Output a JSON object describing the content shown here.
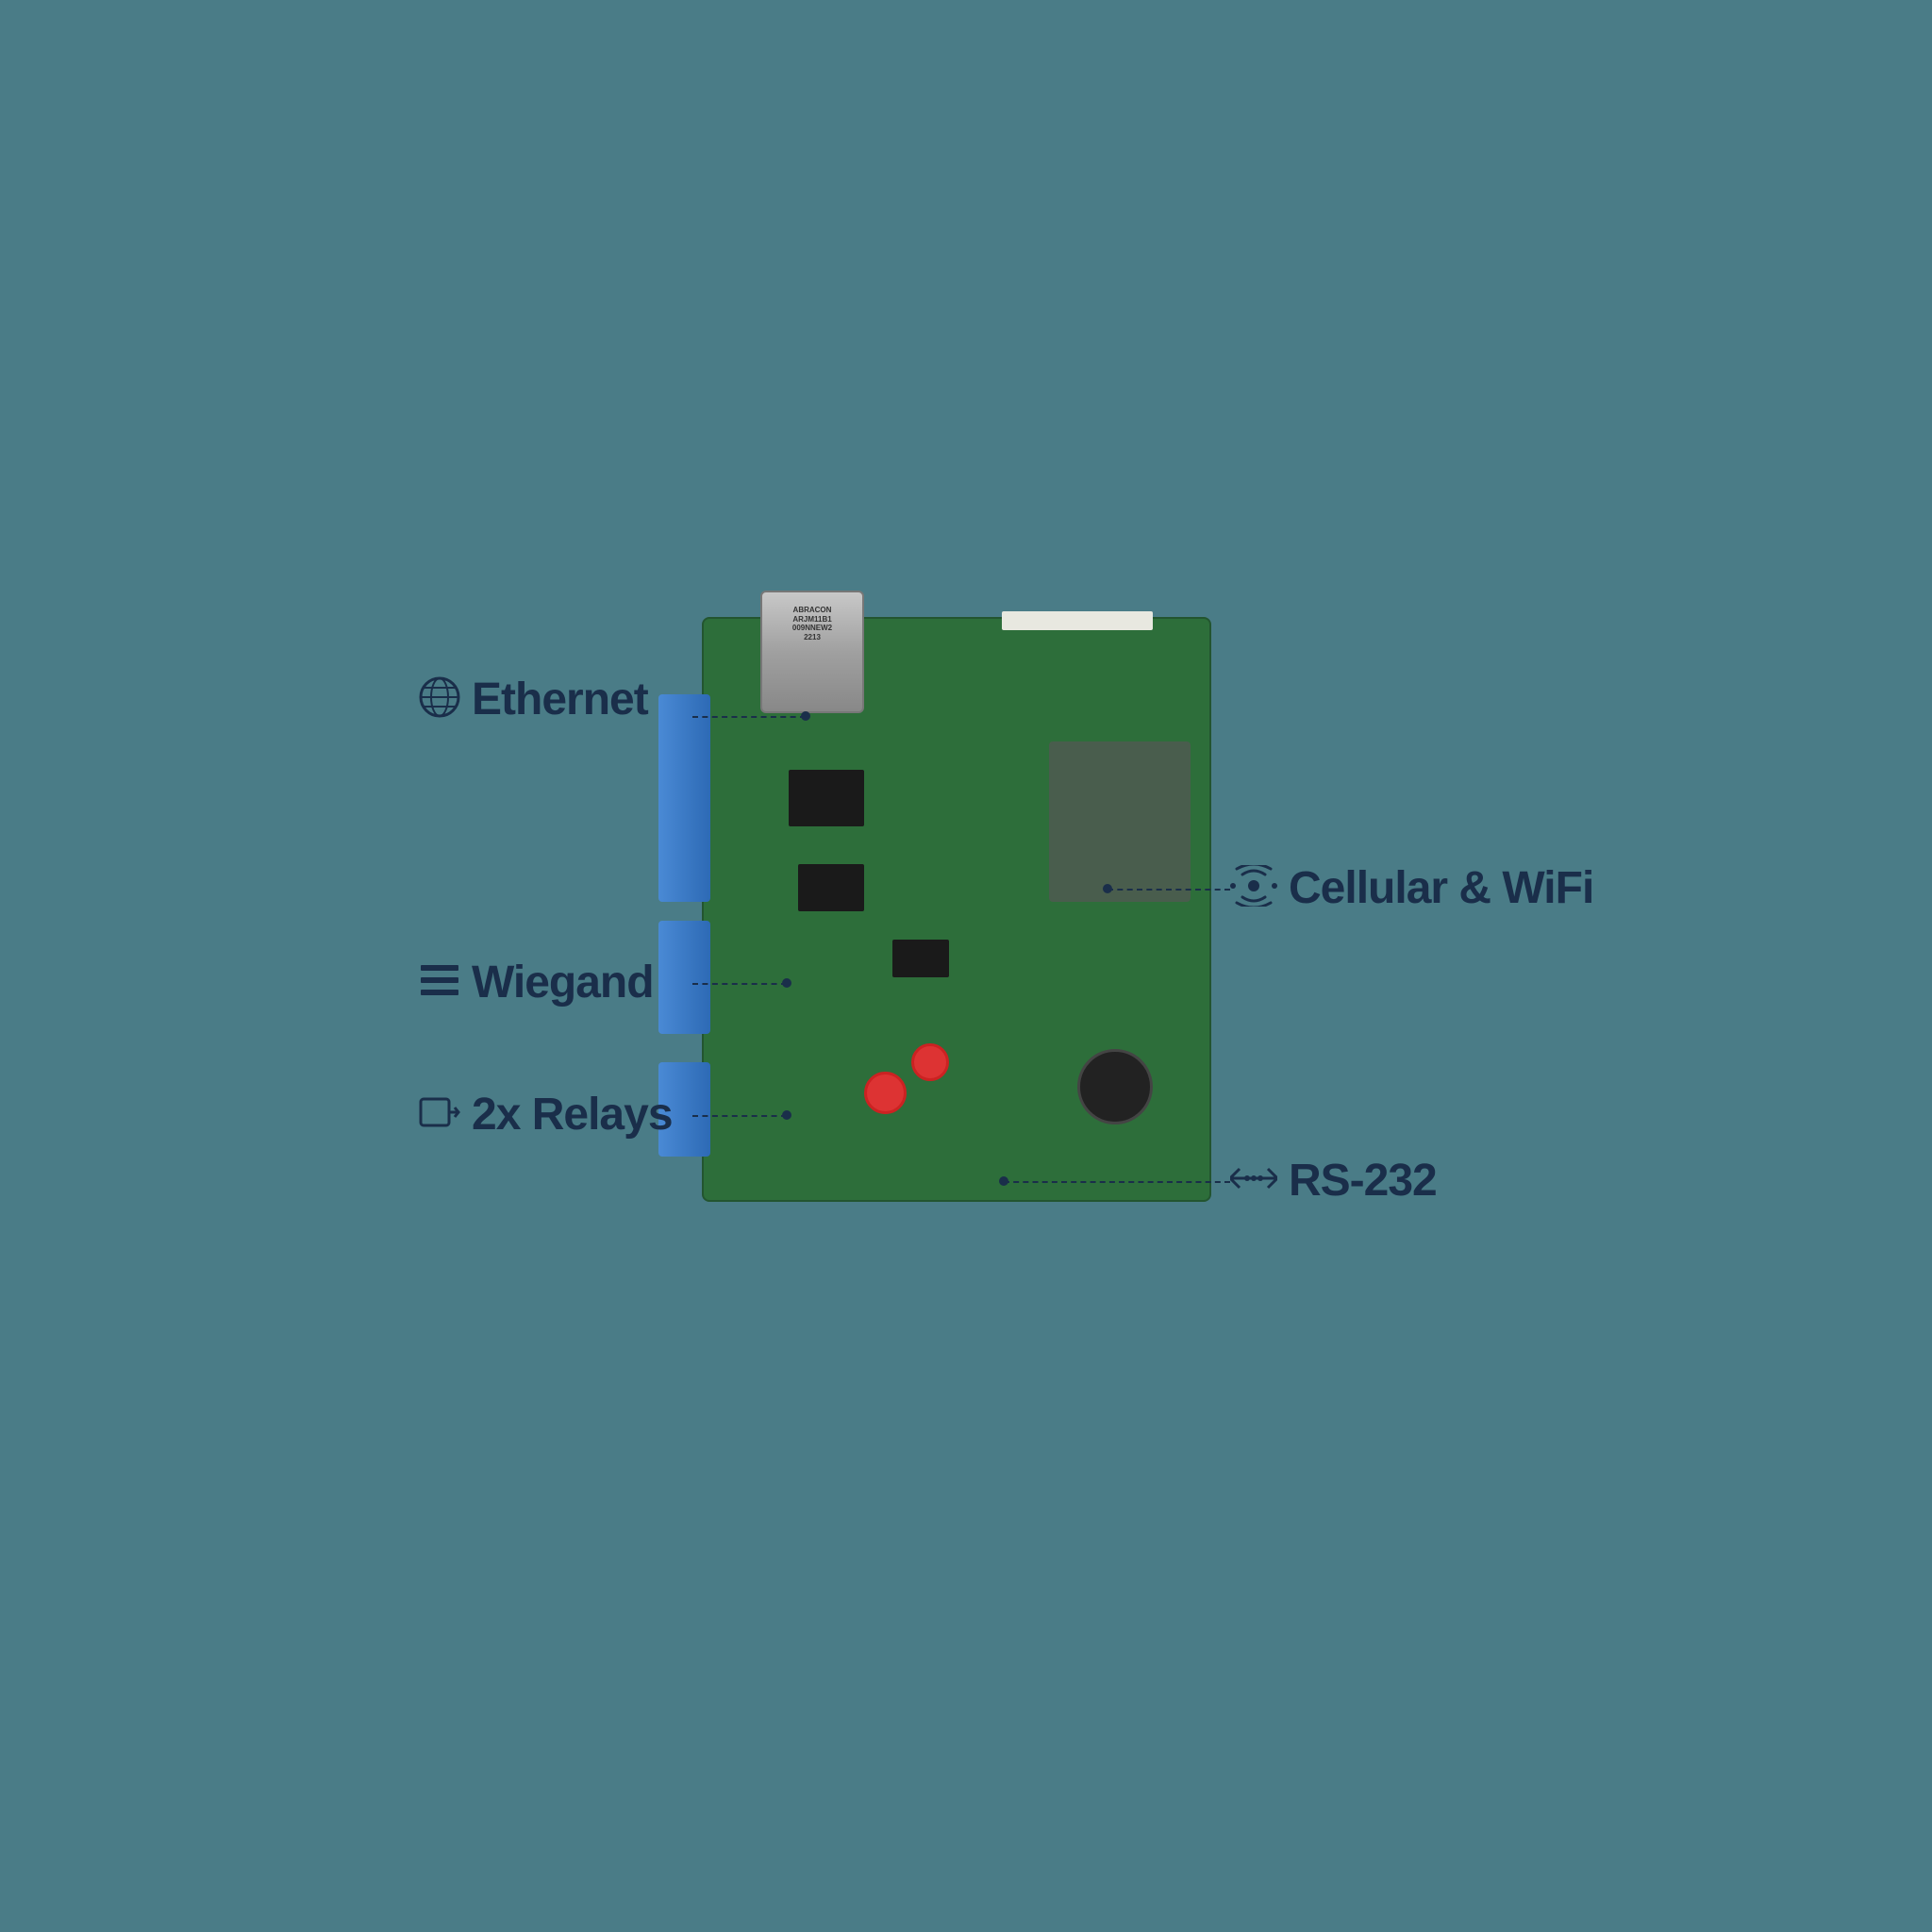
{
  "background_color": "#4a7c87",
  "labels": {
    "ethernet": {
      "text": "Ethernet",
      "icon": "🌐",
      "icon_unicode": "&#xE0; globe"
    },
    "wiegand": {
      "text": "Wiegand",
      "icon": "grid"
    },
    "relays": {
      "text": "2x Relays",
      "icon": "arrow-in-box"
    },
    "cellular_wifi": {
      "text": "Cellular & WiFi",
      "icon": "signal"
    },
    "rs232": {
      "text": "RS-232",
      "icon": "arrows-lr"
    }
  },
  "pcb": {
    "ethernet_jack_label": "ABRACON\nARJM11B1\n009NNEW2\n2213"
  }
}
